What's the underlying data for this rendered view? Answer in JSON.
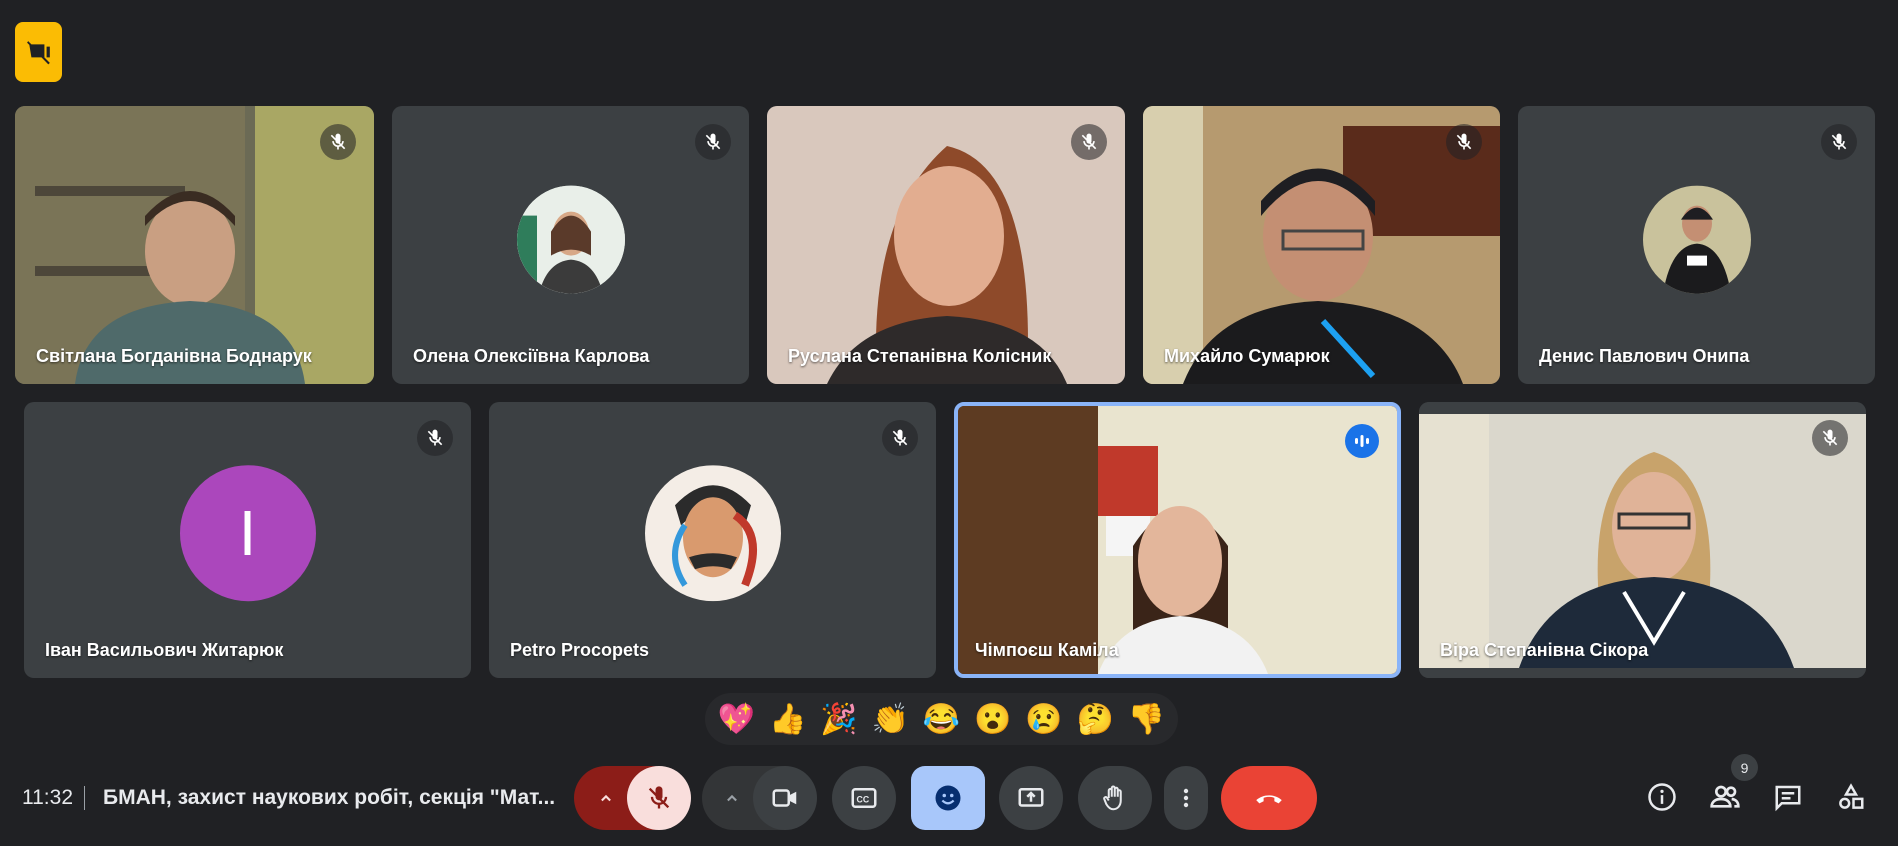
{
  "participants": [
    {
      "name": "Світлана Богданівна Боднарук"
    },
    {
      "name": "Олена Олексіївна Карлова"
    },
    {
      "name": "Руслана Степанівна Колісник"
    },
    {
      "name": "Михайло Сумарюк"
    },
    {
      "name": "Денис Павлович Онипа"
    },
    {
      "name": "Іван Васильович Житарюк",
      "initial": "І",
      "avatar_color": "#ab47bc"
    },
    {
      "name": "Petro Procopets"
    },
    {
      "name": "Чімпоєш Каміла"
    },
    {
      "name": "Віра Степанівна Сікора"
    }
  ],
  "reactions": [
    "💖",
    "👍",
    "🎉",
    "👏",
    "😂",
    "😮",
    "😢",
    "🤔",
    "👎"
  ],
  "meeting": {
    "time": "11:32",
    "title": "БМАН, захист наукових робіт, секція \"Мат..."
  },
  "participant_count": "9",
  "colors": {
    "background": "#202124",
    "tile": "#3c4043",
    "end_call": "#ea4335",
    "mic_muted": "#f9dedc",
    "emoji_active": "#a8c7fa",
    "speaking_border": "#8ab4f8",
    "badge": "#fbbc04"
  }
}
